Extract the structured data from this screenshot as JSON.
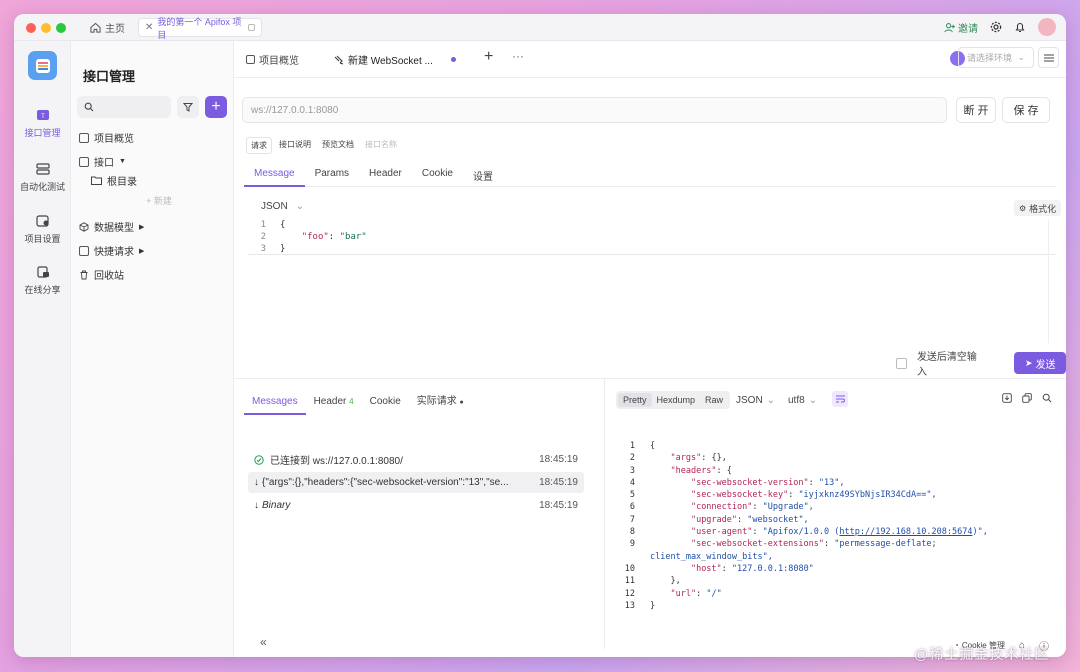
{
  "titlebar": {
    "home_label": "主页",
    "tab_label": "我的第一个 Apifox 项目",
    "invite_label": "邀请",
    "colors": {
      "close": "#ff5f57",
      "minimize": "#febc2e",
      "maximize": "#28c840"
    }
  },
  "rail": {
    "items": [
      {
        "label": "接口管理",
        "icon": "api-icon"
      },
      {
        "label": "自动化测试",
        "icon": "test-icon"
      },
      {
        "label": "项目设置",
        "icon": "settings-icon"
      },
      {
        "label": "在线分享",
        "icon": "share-icon"
      }
    ]
  },
  "tree": {
    "title": "接口管理",
    "items": {
      "overview": "项目概览",
      "api": "接口",
      "root": "根目录",
      "new": "+ 新建",
      "models": "数据模型",
      "quick": "快捷请求",
      "trash": "回收站"
    }
  },
  "doc_tabs": {
    "overview": "项目概览",
    "websocket": "新建 WebSocket ...",
    "env_placeholder": "请选择环境"
  },
  "request": {
    "url": "ws://127.0.0.1:8080",
    "disconnect": "断 开",
    "save": "保 存",
    "sub_tabs": [
      "请求",
      "接口说明",
      "预览文档"
    ],
    "name_placeholder": "接口名称",
    "tabs": [
      "Message",
      "Params",
      "Header",
      "Cookie",
      "设置"
    ],
    "format": "JSON",
    "beautify": "格式化",
    "code": {
      "l1": "{",
      "key": "\"foo\"",
      "colon": ": ",
      "val": "\"bar\"",
      "l3": "}"
    },
    "clear_after_send": "发送后清空输入",
    "send": "发送"
  },
  "response": {
    "tabs": {
      "messages": "Messages",
      "header": "Header",
      "header_count": "4",
      "cookie": "Cookie",
      "actual": "实际请求"
    },
    "messages": [
      {
        "text": "已连接到 ws://127.0.0.1:8080/",
        "time": "18:45:19"
      },
      {
        "text": "{\"args\":{},\"headers\":{\"sec-websocket-version\":\"13\",\"se...",
        "time": "18:45:19"
      },
      {
        "text": "Binary",
        "time": "18:45:19"
      }
    ],
    "views": [
      "Pretty",
      "Hexdump",
      "Raw"
    ],
    "format": "JSON",
    "encoding": "utf8",
    "json": {
      "args_key": "\"args\"",
      "args_val": "{},",
      "headers_key": "\"headers\"",
      "h1k": "\"sec-websocket-version\"",
      "h1v": "\"13\",",
      "h2k": "\"sec-websocket-key\"",
      "h2v": "\"iyjxknz49SYbNjsIR34CdA==\",",
      "h3k": "\"connection\"",
      "h3v": "\"Upgrade\",",
      "h4k": "\"upgrade\"",
      "h4v": "\"websocket\",",
      "h5k": "\"user-agent\"",
      "h5v_pre": "\"Apifox/1.0.0 (",
      "h5v_link": "http://192.168.10.208:5674",
      "h5v_post": ")\",",
      "h6k": "\"sec-websocket-extensions\"",
      "h6v": "\"permessage-deflate;",
      "h6v_cont": "client_max_window_bits\",",
      "h7k": "\"host\"",
      "h7v": "\"127.0.0.1:8080\"",
      "url_key": "\"url\"",
      "url_val": "\"/\""
    }
  },
  "statusbar": {
    "cookie_mgmt": "Cookie 管理"
  },
  "watermark": "@稀土掘金技术社区",
  "accent": "#7b5be0"
}
